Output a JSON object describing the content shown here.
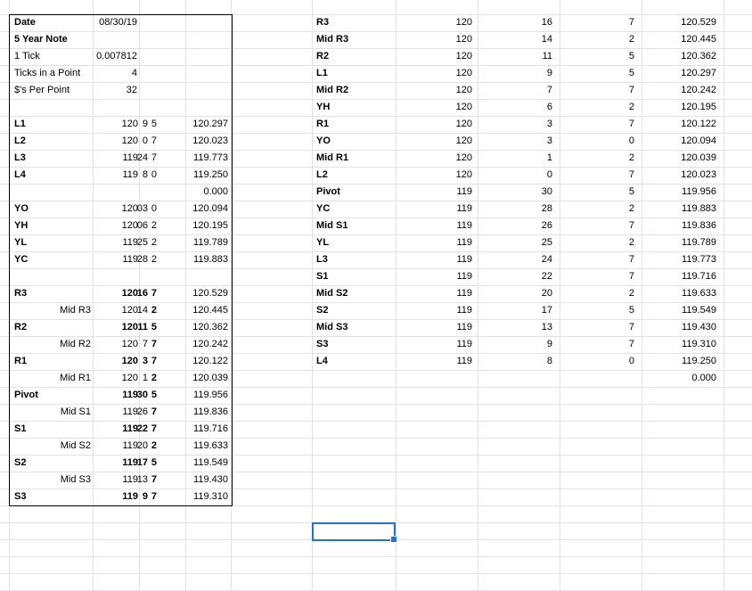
{
  "top_left": [
    {
      "label": "Date",
      "value": "08/30/19"
    },
    {
      "label": "5 Year Note",
      "value": ""
    },
    {
      "label": "1 Tick",
      "value": "0.007812"
    },
    {
      "label": "Ticks in a Point",
      "value": "4"
    },
    {
      "label": "$'s Per Point",
      "value": "32"
    }
  ],
  "levels_left": [
    {
      "label": "L1",
      "handle": "120",
      "tick": "9",
      "frac": "5",
      "price": "120.297"
    },
    {
      "label": "L2",
      "handle": "120",
      "tick": "0",
      "frac": "7",
      "price": "120.023"
    },
    {
      "label": "L3",
      "handle": "119",
      "tick": "24",
      "frac": "7",
      "price": "119.773"
    },
    {
      "label": "L4",
      "handle": "119",
      "tick": "8",
      "frac": "0",
      "price": "119.250"
    },
    {
      "label": "",
      "handle": "",
      "tick": "",
      "frac": "",
      "price": "0.000"
    },
    {
      "label": "YO",
      "handle": "120",
      "tick": "03",
      "frac": "0",
      "price": "120.094"
    },
    {
      "label": "YH",
      "handle": "120",
      "tick": "06",
      "frac": "2",
      "price": "120.195"
    },
    {
      "label": "YL",
      "handle": "119",
      "tick": "25",
      "frac": "2",
      "price": "119.789"
    },
    {
      "label": "YC",
      "handle": "119",
      "tick": "28",
      "frac": "2",
      "price": "119.883"
    }
  ],
  "pivots_left": [
    {
      "label": "R3",
      "sub": "",
      "handle": "120",
      "tick": "16",
      "frac": "7",
      "price": "120.529",
      "bold": true
    },
    {
      "label": "",
      "sub": "Mid R3",
      "handle": "120",
      "tick": "14",
      "frac": "2",
      "price": "120.445",
      "bold": false
    },
    {
      "label": "R2",
      "sub": "",
      "handle": "120",
      "tick": "11",
      "frac": "5",
      "price": "120.362",
      "bold": true
    },
    {
      "label": "",
      "sub": "Mid R2",
      "handle": "120",
      "tick": "7",
      "frac": "7",
      "price": "120.242",
      "bold": false
    },
    {
      "label": "R1",
      "sub": "",
      "handle": "120",
      "tick": "3",
      "frac": "7",
      "price": "120.122",
      "bold": true
    },
    {
      "label": "",
      "sub": "Mid R1",
      "handle": "120",
      "tick": "1",
      "frac": "2",
      "price": "120.039",
      "bold": false
    },
    {
      "label": "Pivot",
      "sub": "",
      "handle": "119",
      "tick": "30",
      "frac": "5",
      "price": "119.956",
      "bold": true
    },
    {
      "label": "",
      "sub": "Mid S1",
      "handle": "119",
      "tick": "26",
      "frac": "7",
      "price": "119.836",
      "bold": false
    },
    {
      "label": "S1",
      "sub": "",
      "handle": "119",
      "tick": "22",
      "frac": "7",
      "price": "119.716",
      "bold": true
    },
    {
      "label": "",
      "sub": "Mid S2",
      "handle": "119",
      "tick": "20",
      "frac": "2",
      "price": "119.633",
      "bold": false
    },
    {
      "label": "S2",
      "sub": "",
      "handle": "119",
      "tick": "17",
      "frac": "5",
      "price": "119.549",
      "bold": true
    },
    {
      "label": "",
      "sub": "Mid S3",
      "handle": "119",
      "tick": "13",
      "frac": "7",
      "price": "119.430",
      "bold": false
    },
    {
      "label": "S3",
      "sub": "",
      "handle": "119",
      "tick": "9",
      "frac": "7",
      "price": "119.310",
      "bold": true
    }
  ],
  "sorted_right": [
    {
      "label": "R3",
      "handle": "120",
      "tick": "16",
      "frac": "7",
      "price": "120.529"
    },
    {
      "label": "Mid R3",
      "handle": "120",
      "tick": "14",
      "frac": "2",
      "price": "120.445"
    },
    {
      "label": "R2",
      "handle": "120",
      "tick": "11",
      "frac": "5",
      "price": "120.362"
    },
    {
      "label": "L1",
      "handle": "120",
      "tick": "9",
      "frac": "5",
      "price": "120.297"
    },
    {
      "label": "Mid R2",
      "handle": "120",
      "tick": "7",
      "frac": "7",
      "price": "120.242"
    },
    {
      "label": "YH",
      "handle": "120",
      "tick": "6",
      "frac": "2",
      "price": "120.195"
    },
    {
      "label": "R1",
      "handle": "120",
      "tick": "3",
      "frac": "7",
      "price": "120.122"
    },
    {
      "label": "YO",
      "handle": "120",
      "tick": "3",
      "frac": "0",
      "price": "120.094"
    },
    {
      "label": "Mid R1",
      "handle": "120",
      "tick": "1",
      "frac": "2",
      "price": "120.039"
    },
    {
      "label": "L2",
      "handle": "120",
      "tick": "0",
      "frac": "7",
      "price": "120.023"
    },
    {
      "label": "Pivot",
      "handle": "119",
      "tick": "30",
      "frac": "5",
      "price": "119.956"
    },
    {
      "label": "YC",
      "handle": "119",
      "tick": "28",
      "frac": "2",
      "price": "119.883"
    },
    {
      "label": "Mid S1",
      "handle": "119",
      "tick": "26",
      "frac": "7",
      "price": "119.836"
    },
    {
      "label": "YL",
      "handle": "119",
      "tick": "25",
      "frac": "2",
      "price": "119.789"
    },
    {
      "label": "L3",
      "handle": "119",
      "tick": "24",
      "frac": "7",
      "price": "119.773"
    },
    {
      "label": "S1",
      "handle": "119",
      "tick": "22",
      "frac": "7",
      "price": "119.716"
    },
    {
      "label": "Mid S2",
      "handle": "119",
      "tick": "20",
      "frac": "2",
      "price": "119.633"
    },
    {
      "label": "S2",
      "handle": "119",
      "tick": "17",
      "frac": "5",
      "price": "119.549"
    },
    {
      "label": "Mid S3",
      "handle": "119",
      "tick": "13",
      "frac": "7",
      "price": "119.430"
    },
    {
      "label": "S3",
      "handle": "119",
      "tick": "9",
      "frac": "7",
      "price": "119.310"
    },
    {
      "label": "L4",
      "handle": "119",
      "tick": "8",
      "frac": "0",
      "price": "119.250"
    },
    {
      "label": "",
      "handle": "",
      "tick": "",
      "frac": "",
      "price": "0.000"
    }
  ],
  "colors": {
    "grid": "#e2e2e2",
    "selection": "#1a73e8",
    "border": "#000000"
  }
}
